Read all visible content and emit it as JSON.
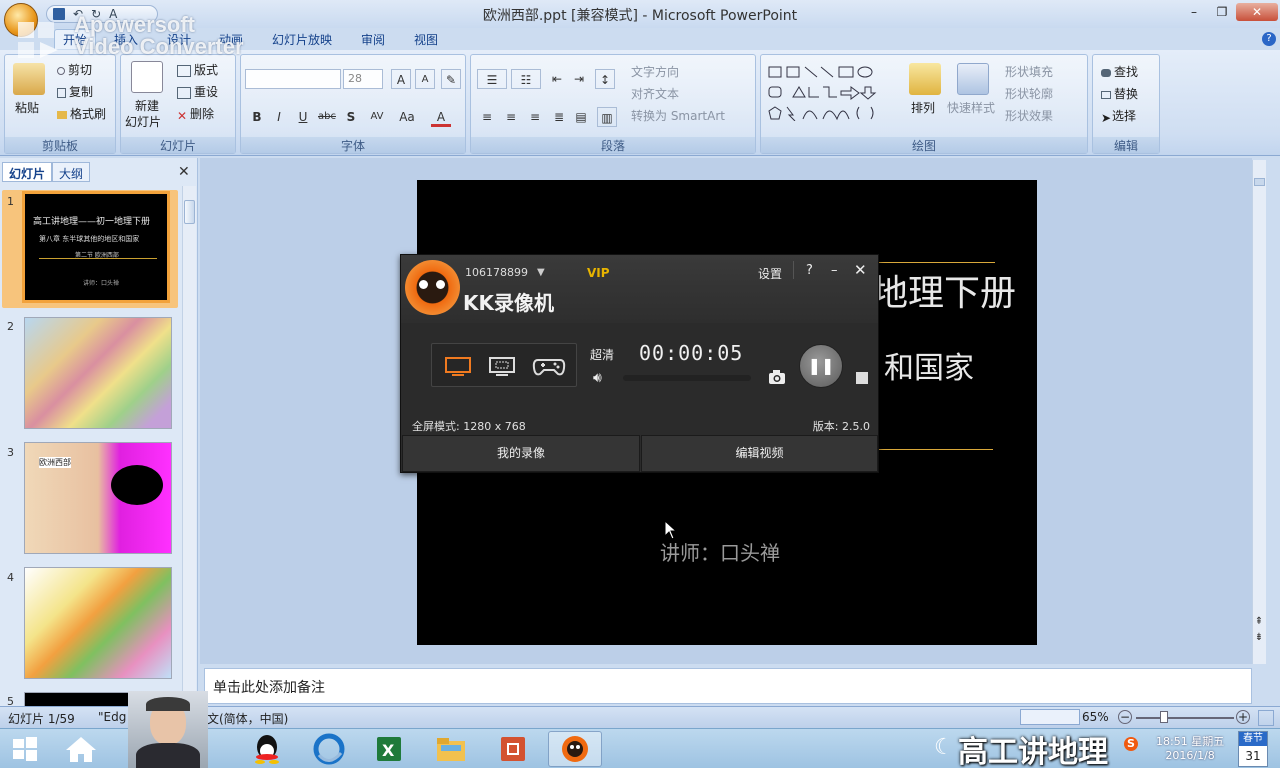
{
  "window": {
    "title": "欧洲西部.ppt [兼容模式] - Microsoft PowerPoint",
    "minimize": "–",
    "maximize": "❐",
    "close": "✕"
  },
  "quick_access": {
    "save_icon": "save-icon",
    "undo": "↶",
    "redo": "↻",
    "font": "A"
  },
  "watermark": {
    "line1": "Apowersoft",
    "line2": "Video Converter"
  },
  "tabs": [
    "开始",
    "插入",
    "设计",
    "动画",
    "幻灯片放映",
    "审阅",
    "视图"
  ],
  "ribbon": {
    "clipboard": {
      "label": "剪贴板",
      "paste": "粘贴",
      "cut": "剪切",
      "copy": "复制",
      "format_painter": "格式刷"
    },
    "slides": {
      "label": "幻灯片",
      "new_slide": "新建",
      "new_slide2": "幻灯片",
      "layout": "版式",
      "reset": "重设",
      "delete": "删除"
    },
    "font": {
      "label": "字体",
      "size": "28"
    },
    "paragraph": {
      "label": "段落",
      "text_direction": "文字方向",
      "align_text": "对齐文本",
      "convert_smartart": "转换为 SmartArt"
    },
    "drawing": {
      "label": "绘图",
      "arrange": "排列",
      "quick_styles": "快速样式",
      "shape_fill": "形状填充",
      "shape_outline": "形状轮廓",
      "shape_effects": "形状效果"
    },
    "editing": {
      "label": "编辑",
      "find": "查找",
      "replace": "替换",
      "select": "选择"
    }
  },
  "left_panel": {
    "tab_slides": "幻灯片",
    "tab_outline": "大纲",
    "close": "✕",
    "slides": [
      {
        "num": "1",
        "title": "高工讲地理——初一地理下册",
        "sub": "第八章 东半球其他的地区和国家",
        "sub2": "第二节 欧洲西部",
        "author": "讲师：口头禅"
      },
      {
        "num": "2"
      },
      {
        "num": "3",
        "title": "欧洲西部"
      },
      {
        "num": "4"
      },
      {
        "num": "5"
      }
    ]
  },
  "slide": {
    "line1": "地理下册",
    "line2": "和国家",
    "author": "讲师：口头禅"
  },
  "notes": {
    "placeholder": "单击此处添加备注"
  },
  "status": {
    "slide_pos": "幻灯片 1/59",
    "theme": "\"Edg",
    "language": "文(简体，中国)",
    "zoom": "65%"
  },
  "kk": {
    "account": "106178899",
    "vip": "VIP",
    "brand": "KK录像机",
    "settings": "设置",
    "help": "?",
    "minimize": "–",
    "close": "✕",
    "quality": "超清",
    "time": "00:00:05",
    "mode_info": "全屏模式: 1280 x 768",
    "version": "版本: 2.5.0",
    "my_recordings": "我的录像",
    "edit_video": "编辑视频"
  },
  "taskbar": {
    "clock_time": "18:51 星期五",
    "clock_date": "2016/1/8",
    "calendar_top": "春节",
    "calendar_day": "31",
    "overlay_caption": "高工讲地理"
  },
  "colors": {
    "ribbon": "#cfdef2",
    "kk_bg": "#2b2b2b",
    "accent_orange": "#f06a10",
    "slide_bg": "#000000"
  }
}
